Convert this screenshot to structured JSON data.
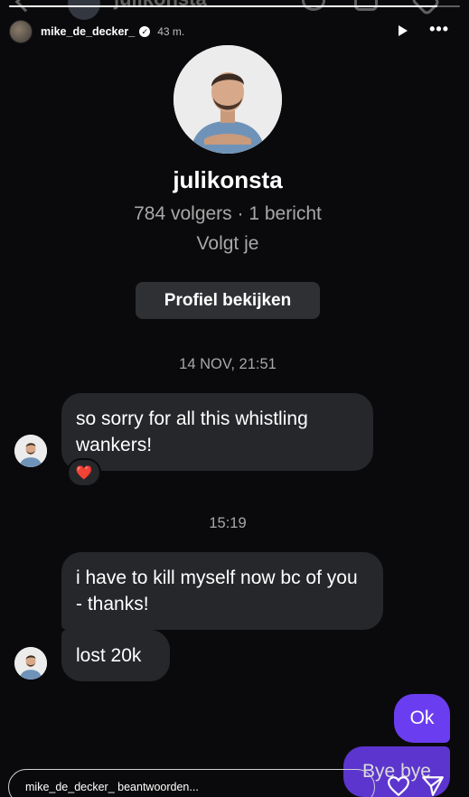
{
  "ghost_header": {
    "name": "julikonsta"
  },
  "story": {
    "username": "mike_de_decker_",
    "time_ago": "43 m.",
    "progress_fraction": 0.95,
    "verified_icon": "verified-badge-icon",
    "play_icon": "play-icon",
    "more_icon": "more-options-icon"
  },
  "profile": {
    "username": "julikonsta",
    "stats": "784 volgers · 1 bericht",
    "follows_you": "Volgt je",
    "view_profile_label": "Profiel bekijken"
  },
  "thread": {
    "separator_1": "14 NOV, 21:51",
    "message_1": "so sorry for all this whistling wankers!",
    "reaction_1": "❤️",
    "separator_2": "15:19",
    "message_2": "i have to kill myself now bc of you - thanks!",
    "message_3": "lost 20k",
    "sent_1": "Ok",
    "sent_2": "Bye bye"
  },
  "reply": {
    "placeholder": "mike_de_decker_ beantwoorden...",
    "heart_icon": "heart-outline-icon",
    "send_icon": "send-paper-plane-icon"
  },
  "colors": {
    "background": "#0a0a0c",
    "received_bubble": "#26272b",
    "sent_bubble": "#6b3df0",
    "secondary_text": "#a8a8a8"
  }
}
